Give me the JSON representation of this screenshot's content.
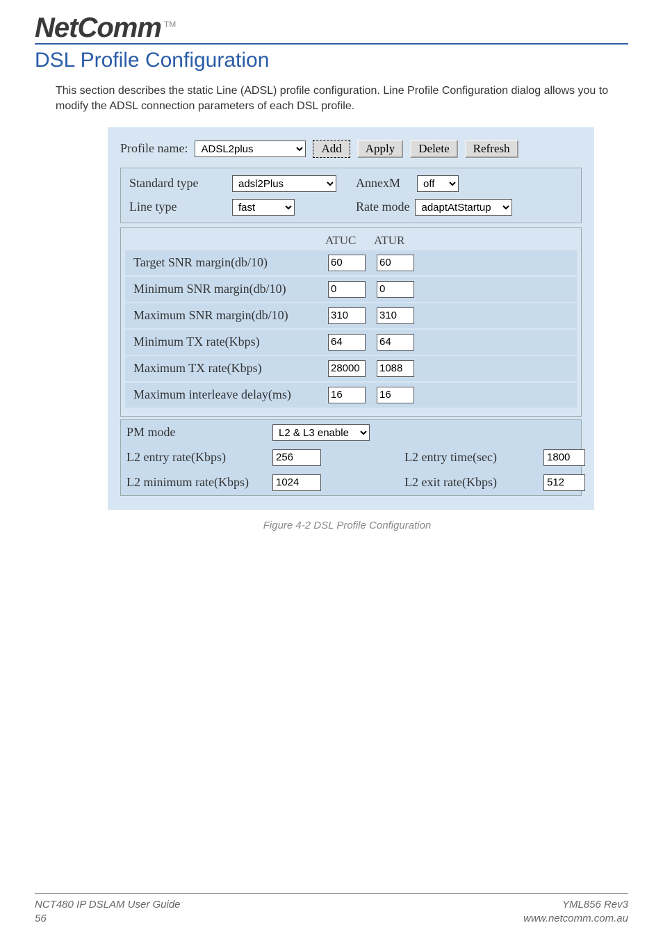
{
  "logo": {
    "text": "NetComm",
    "tm": "TM"
  },
  "heading": "DSL Profile Configuration",
  "intro": "This section describes the static Line (ADSL) profile configuration. Line Profile Configuration dialog allows you to modify the ADSL connection parameters of each DSL profile.",
  "panel": {
    "profile_label": "Profile name:",
    "profile_value": "ADSL2plus",
    "buttons": {
      "add": "Add",
      "apply": "Apply",
      "delete": "Delete",
      "refresh": "Refresh"
    },
    "std_type_label": "Standard type",
    "std_type_value": "adsl2Plus",
    "annexm_label": "AnnexM",
    "annexm_value": "off",
    "line_type_label": "Line type",
    "line_type_value": "fast",
    "rate_mode_label": "Rate mode",
    "rate_mode_value": "adaptAtStartup",
    "col_atuc": "ATUC",
    "col_atur": "ATUR",
    "rows": [
      {
        "label": "Target SNR margin(db/10)",
        "atuc": "60",
        "atur": "60"
      },
      {
        "label": "Minimum SNR margin(db/10)",
        "atuc": "0",
        "atur": "0"
      },
      {
        "label": "Maximum SNR margin(db/10)",
        "atuc": "310",
        "atur": "310"
      },
      {
        "label": "Minimum TX rate(Kbps)",
        "atuc": "64",
        "atur": "64"
      },
      {
        "label": "Maximum TX rate(Kbps)",
        "atuc": "28000",
        "atur": "1088"
      },
      {
        "label": "Maximum interleave delay(ms)",
        "atuc": "16",
        "atur": "16"
      }
    ],
    "pm_mode_label": "PM mode",
    "pm_mode_value": "L2 & L3 enable",
    "l2_entry_rate_label": "L2 entry rate(Kbps)",
    "l2_entry_rate_value": "256",
    "l2_entry_time_label": "L2 entry time(sec)",
    "l2_entry_time_value": "1800",
    "l2_min_rate_label": "L2 minimum rate(Kbps)",
    "l2_min_rate_value": "1024",
    "l2_exit_rate_label": "L2 exit rate(Kbps)",
    "l2_exit_rate_value": "512"
  },
  "caption": "Figure 4-2 DSL Profile Configuration",
  "footer": {
    "left1": "NCT480 IP DSLAM User Guide",
    "left2": "56",
    "right1": "YML856 Rev3",
    "right2": "www.netcomm.com.au"
  }
}
